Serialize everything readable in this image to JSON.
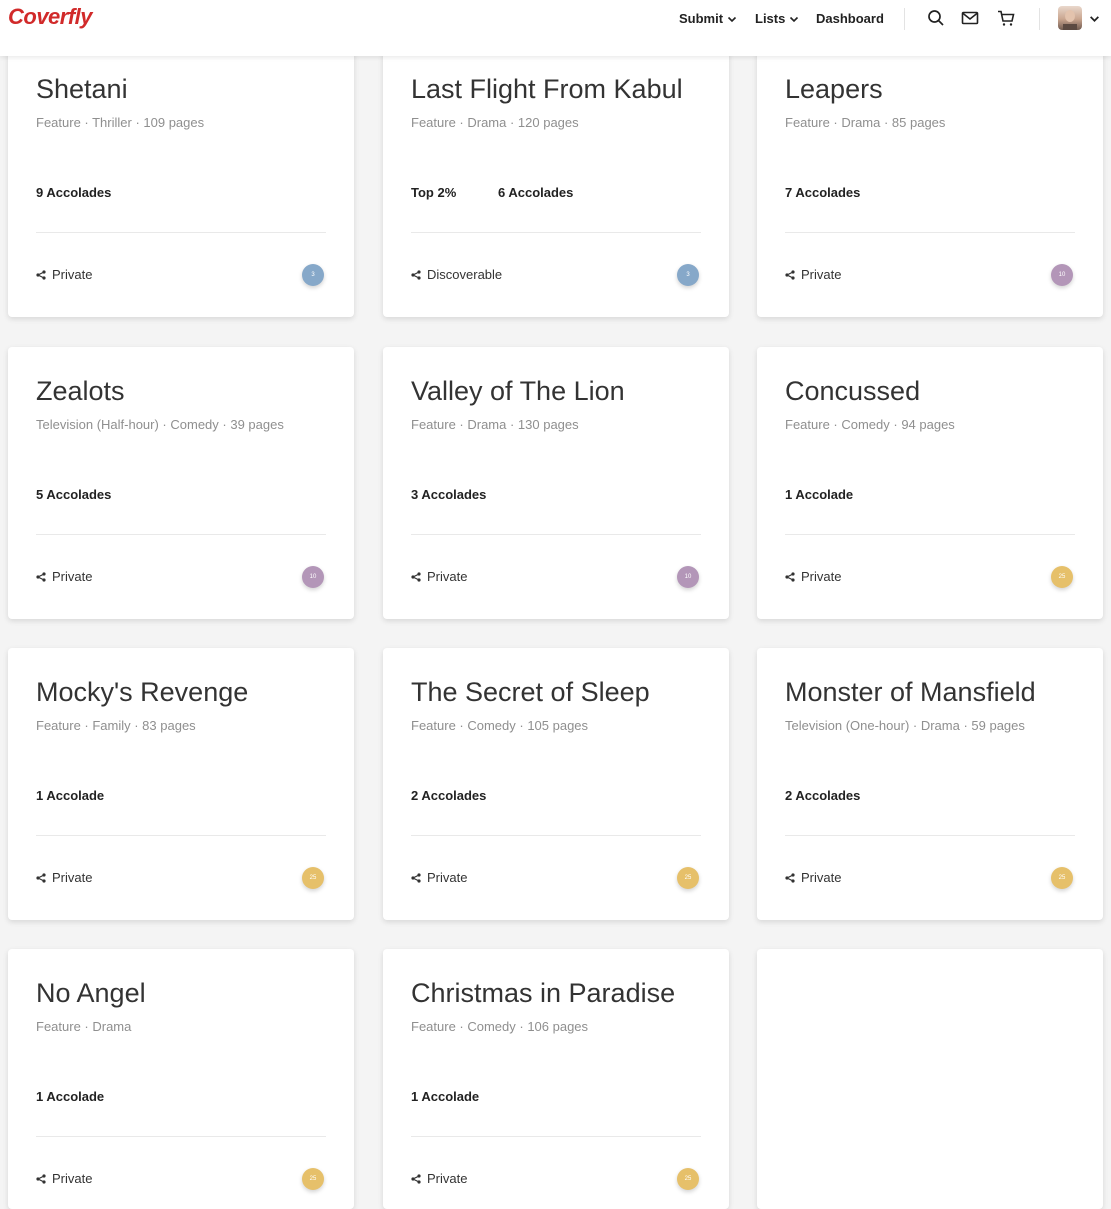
{
  "header": {
    "logo": "Coverfly",
    "nav": [
      {
        "label": "Submit",
        "dropdown": true
      },
      {
        "label": "Lists",
        "dropdown": true
      },
      {
        "label": "Dashboard",
        "dropdown": false
      }
    ],
    "icons": [
      "search-icon",
      "mail-icon",
      "cart-icon"
    ]
  },
  "colors": {
    "brand": "#d12a2a",
    "badge_blue": "#86a8c9",
    "badge_purple": "#b396b8",
    "badge_gold": "#e6c06a"
  },
  "projects": [
    {
      "title": "Shetani",
      "meta": "Feature · Thriller · 109 pages",
      "top": "",
      "accolades": "9 Accolades",
      "share": "Private",
      "badge": "3",
      "badge_color": "#86a8c9"
    },
    {
      "title": "Last Flight From Kabul",
      "meta": "Feature · Drama · 120 pages",
      "top": "Top 2%",
      "accolades": "6 Accolades",
      "share": "Discoverable",
      "badge": "3",
      "badge_color": "#86a8c9"
    },
    {
      "title": "Leapers",
      "meta": "Feature · Drama · 85 pages",
      "top": "",
      "accolades": "7 Accolades",
      "share": "Private",
      "badge": "10",
      "badge_color": "#b396b8"
    },
    {
      "title": "Zealots",
      "meta": "Television (Half-hour) · Comedy · 39 pages",
      "top": "",
      "accolades": "5 Accolades",
      "share": "Private",
      "badge": "10",
      "badge_color": "#b396b8"
    },
    {
      "title": "Valley of The Lion",
      "meta": "Feature · Drama · 130 pages",
      "top": "",
      "accolades": "3 Accolades",
      "share": "Private",
      "badge": "10",
      "badge_color": "#b396b8"
    },
    {
      "title": "Concussed",
      "meta": "Feature · Comedy · 94 pages",
      "top": "",
      "accolades": "1 Accolade",
      "share": "Private",
      "badge": "25",
      "badge_color": "#e6c06a"
    },
    {
      "title": "Mocky's Revenge",
      "meta": "Feature · Family · 83 pages",
      "top": "",
      "accolades": "1 Accolade",
      "share": "Private",
      "badge": "25",
      "badge_color": "#e6c06a"
    },
    {
      "title": "The Secret of Sleep",
      "meta": "Feature · Comedy · 105 pages",
      "top": "",
      "accolades": "2 Accolades",
      "share": "Private",
      "badge": "25",
      "badge_color": "#e6c06a"
    },
    {
      "title": "Monster of Mansfield",
      "meta": "Television (One-hour) · Drama · 59 pages",
      "top": "",
      "accolades": "2 Accolades",
      "share": "Private",
      "badge": "25",
      "badge_color": "#e6c06a"
    },
    {
      "title": "No Angel",
      "meta": "Feature · Drama",
      "top": "",
      "accolades": "1 Accolade",
      "share": "Private",
      "badge": "25",
      "badge_color": "#e6c06a"
    },
    {
      "title": "Christmas in Paradise",
      "meta": "Feature · Comedy · 106 pages",
      "top": "",
      "accolades": "1 Accolade",
      "share": "Private",
      "badge": "25",
      "badge_color": "#e6c06a"
    }
  ]
}
